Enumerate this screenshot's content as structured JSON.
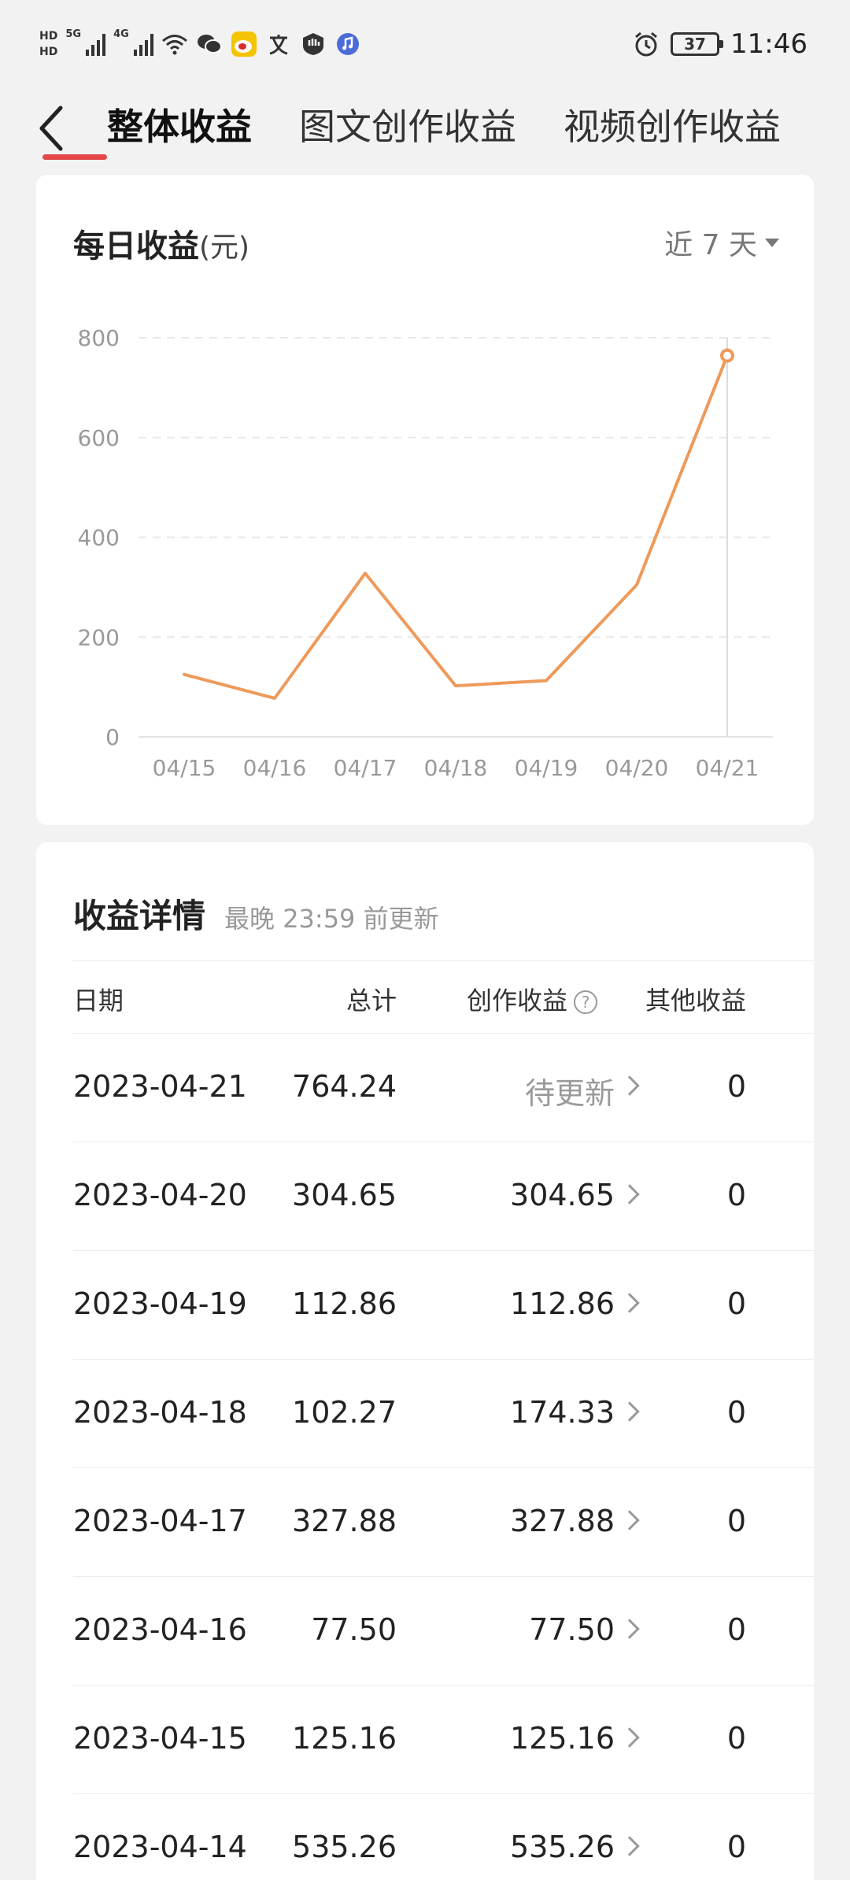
{
  "status_bar": {
    "hd_top": "HD",
    "hd_bottom": "HD",
    "net1": "5G",
    "net2": "4G",
    "battery": "37",
    "time": "11:46",
    "icons": [
      "wifi-icon",
      "wechat-icon",
      "weibo-icon",
      "translate-icon",
      "shield-icon",
      "music-icon",
      "alarm-icon"
    ]
  },
  "nav": {
    "tabs": [
      {
        "label": "整体收益",
        "active": true
      },
      {
        "label": "图文创作收益",
        "active": false
      },
      {
        "label": "视频创作收益",
        "active": false
      }
    ]
  },
  "chart_card": {
    "title": "每日收益",
    "unit": "(元)",
    "range": "近 7 天"
  },
  "chart_data": {
    "type": "line",
    "categories": [
      "04/15",
      "04/16",
      "04/17",
      "04/18",
      "04/19",
      "04/20",
      "04/21"
    ],
    "values": [
      125.16,
      77.5,
      327.88,
      102.27,
      112.86,
      304.65,
      764.24
    ],
    "yticks": [
      0,
      200,
      400,
      600,
      800
    ],
    "ylim": [
      0,
      800
    ],
    "grid": true,
    "color": "#ee9a5a",
    "highlight_index": 6
  },
  "detail": {
    "title": "收益详情",
    "subtitle": "最晚 23:59 前更新",
    "columns": {
      "date": "日期",
      "total": "总计",
      "creation": "创作收益",
      "help": "?",
      "other": "其他收益"
    },
    "rows": [
      {
        "date": "2023-04-21",
        "total": "764.24",
        "creation": "待更新",
        "pending": true,
        "other": "0"
      },
      {
        "date": "2023-04-20",
        "total": "304.65",
        "creation": "304.65",
        "pending": false,
        "other": "0"
      },
      {
        "date": "2023-04-19",
        "total": "112.86",
        "creation": "112.86",
        "pending": false,
        "other": "0"
      },
      {
        "date": "2023-04-18",
        "total": "102.27",
        "creation": "174.33",
        "pending": false,
        "other": "0"
      },
      {
        "date": "2023-04-17",
        "total": "327.88",
        "creation": "327.88",
        "pending": false,
        "other": "0"
      },
      {
        "date": "2023-04-16",
        "total": "77.50",
        "creation": "77.50",
        "pending": false,
        "other": "0"
      },
      {
        "date": "2023-04-15",
        "total": "125.16",
        "creation": "125.16",
        "pending": false,
        "other": "0"
      },
      {
        "date": "2023-04-14",
        "total": "535.26",
        "creation": "535.26",
        "pending": false,
        "other": "0"
      }
    ]
  }
}
